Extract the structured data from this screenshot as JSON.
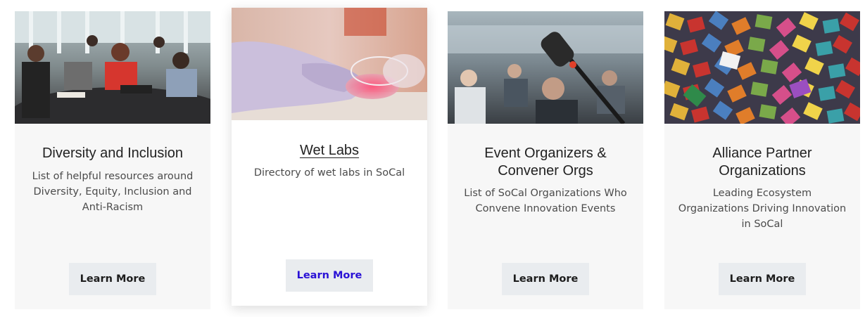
{
  "cards": [
    {
      "title": "Diversity and Inclusion",
      "description": "List of helpful resources around Diversity, Equity, Inclusion and Anti-Racism",
      "button": "Learn More",
      "image": "people-meeting-photo"
    },
    {
      "title": "Wet Labs",
      "description": "Directory of wet labs in SoCal",
      "button": "Learn More",
      "image": "petri-dish-glove-photo"
    },
    {
      "title": "Event Organizers & Convener Orgs",
      "description": "List of SoCal Organizations Who Convene Innovation Events",
      "button": "Learn More",
      "image": "conference-microphone-photo"
    },
    {
      "title": "Alliance Partner Organizations",
      "description": "Leading Ecosystem Organizations Driving Innovation in SoCal",
      "button": "Learn More",
      "image": "puzzle-pieces-photo"
    }
  ],
  "colors": {
    "card_bg": "#f7f7f7",
    "button_bg": "#e9ecef",
    "hover_link": "#2a12d6"
  }
}
